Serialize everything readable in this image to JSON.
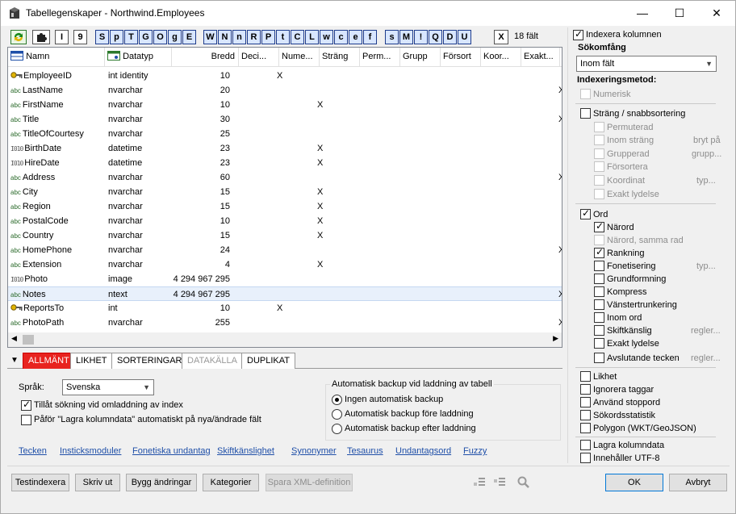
{
  "window": {
    "title": "Tabellegenskaper - Northwind.Employees",
    "minimize": "—",
    "maximize": "☐",
    "close": "✕"
  },
  "toolbar": {
    "buttons": [
      "S",
      "p",
      "T",
      "G",
      "O",
      "g",
      "E",
      "W",
      "N",
      "n",
      "R",
      "P",
      "t",
      "C",
      "L",
      "w",
      "c",
      "e",
      "f",
      "s",
      "M",
      "!",
      "Q",
      "D",
      "U"
    ],
    "single": [
      "I",
      "9"
    ],
    "close": "X",
    "field_count": "18 fält"
  },
  "grid": {
    "headers": [
      "Namn",
      "Datatyp",
      "Bredd",
      "Deci...",
      "Nume...",
      "Sträng",
      "Perm...",
      "Grupp",
      "Försort",
      "Koor...",
      "Exakt...",
      "("
    ],
    "rows": [
      {
        "type": "key",
        "name": "EmployeeID",
        "datatype": "int identity",
        "width": "10",
        "num": "X",
        "str": "",
        "end": ""
      },
      {
        "type": "abc",
        "name": "LastName",
        "datatype": "nvarchar",
        "width": "20",
        "num": "",
        "str": "",
        "end": "X"
      },
      {
        "type": "abc",
        "name": "FirstName",
        "datatype": "nvarchar",
        "width": "10",
        "num": "",
        "str": "X",
        "end": ""
      },
      {
        "type": "abc",
        "name": "Title",
        "datatype": "nvarchar",
        "width": "30",
        "num": "",
        "str": "",
        "end": "X"
      },
      {
        "type": "abc",
        "name": "TitleOfCourtesy",
        "datatype": "nvarchar",
        "width": "25",
        "num": "",
        "str": "",
        "end": ""
      },
      {
        "type": "bin",
        "name": "BirthDate",
        "datatype": "datetime",
        "width": "23",
        "num": "",
        "str": "X",
        "end": ""
      },
      {
        "type": "bin",
        "name": "HireDate",
        "datatype": "datetime",
        "width": "23",
        "num": "",
        "str": "X",
        "end": ""
      },
      {
        "type": "abc",
        "name": "Address",
        "datatype": "nvarchar",
        "width": "60",
        "num": "",
        "str": "",
        "end": "X"
      },
      {
        "type": "abc",
        "name": "City",
        "datatype": "nvarchar",
        "width": "15",
        "num": "",
        "str": "X",
        "end": ""
      },
      {
        "type": "abc",
        "name": "Region",
        "datatype": "nvarchar",
        "width": "15",
        "num": "",
        "str": "X",
        "end": ""
      },
      {
        "type": "abc",
        "name": "PostalCode",
        "datatype": "nvarchar",
        "width": "10",
        "num": "",
        "str": "X",
        "end": ""
      },
      {
        "type": "abc",
        "name": "Country",
        "datatype": "nvarchar",
        "width": "15",
        "num": "",
        "str": "X",
        "end": ""
      },
      {
        "type": "abc",
        "name": "HomePhone",
        "datatype": "nvarchar",
        "width": "24",
        "num": "",
        "str": "",
        "end": "X"
      },
      {
        "type": "abc",
        "name": "Extension",
        "datatype": "nvarchar",
        "width": "4",
        "num": "",
        "str": "X",
        "end": ""
      },
      {
        "type": "bin",
        "name": "Photo",
        "datatype": "image",
        "width": "4 294 967 295",
        "num": "",
        "str": "",
        "end": ""
      },
      {
        "type": "abc",
        "name": "Notes",
        "datatype": "ntext",
        "width": "4 294 967 295",
        "num": "",
        "str": "",
        "end": "X",
        "selected": true
      },
      {
        "type": "key",
        "name": "ReportsTo",
        "datatype": "int",
        "width": "10",
        "num": "X",
        "str": "",
        "end": ""
      },
      {
        "type": "abc",
        "name": "PhotoPath",
        "datatype": "nvarchar",
        "width": "255",
        "num": "",
        "str": "",
        "end": "X"
      }
    ]
  },
  "tabs": [
    {
      "label": "ALLMÄNT",
      "state": "active"
    },
    {
      "label": "LIKHET",
      "state": "normal"
    },
    {
      "label": "SORTERINGAR",
      "state": "normal"
    },
    {
      "label": "DATAKÄLLA",
      "state": "disabled"
    },
    {
      "label": "DUPLIKAT",
      "state": "normal"
    }
  ],
  "general": {
    "language_label": "Språk:",
    "language_value": "Svenska",
    "allow_search": "Tillåt sökning vid omladdning av index",
    "allow_search_checked": true,
    "apply_store": "Påför \"Lagra kolumndata\" automatiskt på nya/ändrade fält",
    "apply_store_checked": false,
    "backup_title": "Automatisk backup vid laddning av tabell",
    "backup_options": [
      "Ingen automatisk backup",
      "Automatisk backup före laddning",
      "Automatisk backup efter laddning"
    ],
    "backup_selected": 0
  },
  "links": [
    "Tecken",
    "Insticksmoduler",
    "Fonetiska undantag",
    "Skiftkänslighet",
    "Synonymer",
    "Tesaurus",
    "Undantagsord",
    "Fuzzy"
  ],
  "buttons": {
    "test": "Testindexera",
    "print": "Skriv ut",
    "build": "Bygg ändringar",
    "categories": "Kategorier",
    "save_xml": "Spara XML-definition",
    "ok": "OK",
    "cancel": "Avbryt"
  },
  "index_panel": {
    "index_column": "Indexera kolumnen",
    "search_scope_title": "Sökomfång",
    "search_scope_value": "Inom fält",
    "method_title": "Indexeringsmetod:",
    "numeric": "Numerisk",
    "string_sort": "Sträng / snabbsortering",
    "permuted": "Permuterad",
    "within_string": "Inom sträng",
    "within_string_hint": "bryt på",
    "grouped": "Grupperad",
    "grouped_hint": "grupp...",
    "presort": "Försortera",
    "coordinate": "Koordinat",
    "coordinate_hint": "typ...",
    "exact_sound": "Exakt lydelse",
    "word": "Ord",
    "near": "Närord",
    "near_same": "Närord, samma rad",
    "ranking": "Rankning",
    "phonetics": "Fonetisering",
    "phonetics_hint": "typ...",
    "stemming": "Grundformning",
    "compress": "Kompress",
    "left_trunc": "Vänstertrunkering",
    "within_word": "Inom ord",
    "case_sensitive": "Skiftkänslig",
    "case_hint": "regler...",
    "exact_sound2": "Exakt lydelse",
    "end_chars": "Avslutande tecken",
    "end_hint": "regler...",
    "similarity": "Likhet",
    "ignore_tags": "Ignorera taggar",
    "stopwords": "Använd stoppord",
    "word_stats": "Sökordsstatistik",
    "polygon": "Polygon (WKT/GeoJSON)",
    "store_data": "Lagra kolumndata",
    "utf8": "Innehåller UTF-8"
  }
}
